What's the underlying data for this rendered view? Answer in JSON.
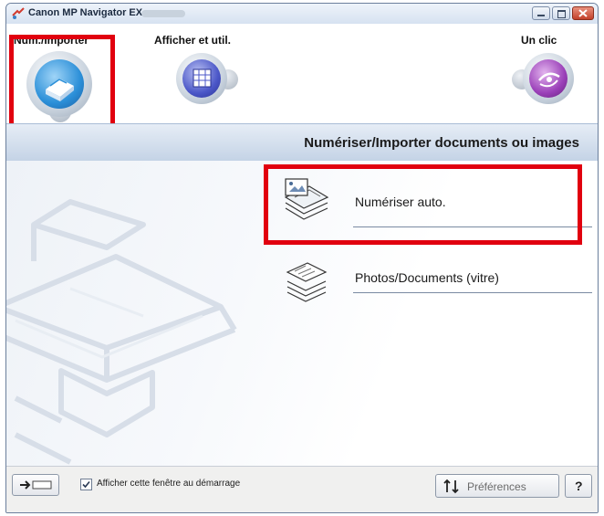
{
  "window": {
    "title": "Canon MP Navigator EX"
  },
  "toolbar": {
    "modes": [
      {
        "label": "Num./Importer",
        "icon": "scanner-icon",
        "selected": true
      },
      {
        "label": "Afficher et util.",
        "icon": "grid-view-icon",
        "selected": false
      },
      {
        "label": "Un clic",
        "icon": "one-click-icon",
        "selected": false
      }
    ]
  },
  "section": {
    "title": "Numériser/Importer documents ou images"
  },
  "options": [
    {
      "label": "Numériser auto.",
      "icon": "auto-scan-icon",
      "highlighted": true
    },
    {
      "label": "Photos/Documents (vitre)",
      "icon": "photos-documents-icon",
      "highlighted": false
    }
  ],
  "footer": {
    "startup_checkbox_label": "Afficher cette fenêtre au démarrage",
    "startup_checkbox_checked": true,
    "preferences_label": "Préférences",
    "help_label": "?"
  },
  "colors": {
    "highlight": "#e1000f",
    "accent": "#3c7fc4",
    "header_band": "#c4d3e6"
  }
}
